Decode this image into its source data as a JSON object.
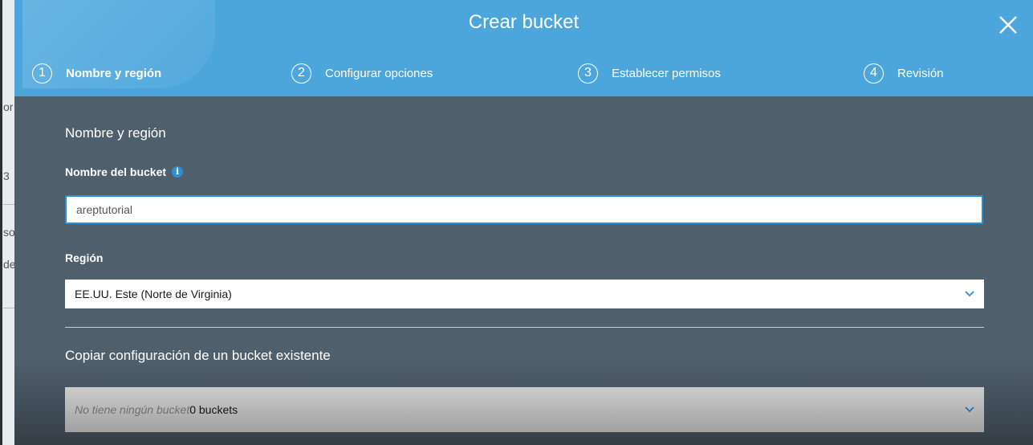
{
  "modal": {
    "title": "Crear bucket",
    "close_icon": "close-icon"
  },
  "steps": [
    {
      "number": "1",
      "label": "Nombre y región",
      "active": true
    },
    {
      "number": "2",
      "label": "Configurar opciones",
      "active": false
    },
    {
      "number": "3",
      "label": "Establecer permisos",
      "active": false
    },
    {
      "number": "4",
      "label": "Revisión",
      "active": false
    }
  ],
  "form": {
    "section_title": "Nombre y región",
    "bucket_name": {
      "label": "Nombre del bucket",
      "info_icon": "info-icon",
      "value": "areptutorial"
    },
    "region": {
      "label": "Región",
      "selected": "EE.UU. Este (Norte de Virginia)"
    },
    "copy_settings": {
      "title": "Copiar configuración de un bucket existente",
      "placeholder": "No tiene ningún bucket",
      "count": "0 buckets"
    }
  },
  "background_page": {
    "fragments": [
      "or",
      "3",
      "so",
      "de"
    ]
  },
  "colors": {
    "header": "#4ca6dc",
    "body": "#505f6c",
    "focus": "#2c8fd6"
  }
}
